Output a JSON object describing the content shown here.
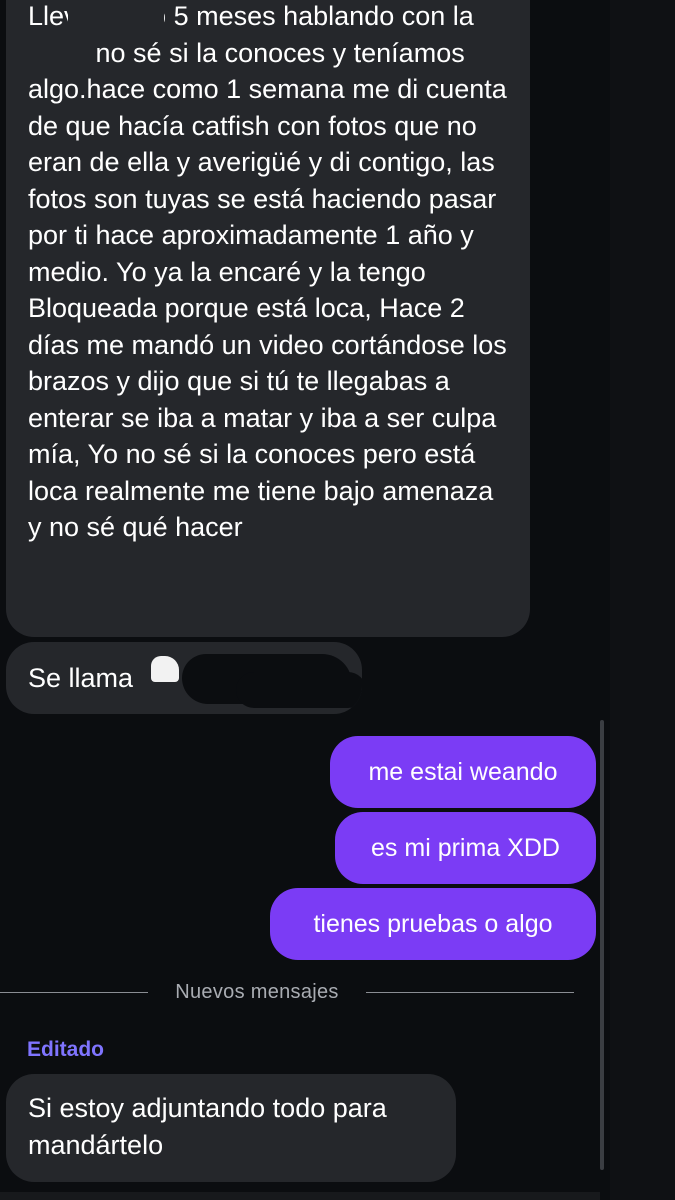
{
  "messages": {
    "incoming_long": "Llevo como 5 meses hablando con la          no sé si la conoces y teníamos algo.hace como 1 semana me di cuenta de que hacía catfish con fotos que no eran de ella y averigüé y di contigo, las fotos son tuyas se está haciendo pasar por ti hace aproximadamente 1 año y medio. Yo ya la encaré y la tengo Bloqueada porque está loca, Hace 2 días me mandó un video cortándose los brazos y dijo que si tú te llegabas a enterar se iba a matar y iba a ser culpa mía, Yo no sé si la conoces pero está loca realmente me tiene bajo amenaza y no sé qué hacer",
    "incoming_name": "Se llama",
    "outgoing_1": "me estai weando",
    "outgoing_2": "es mi prima XDD",
    "outgoing_3": "tienes pruebas o algo",
    "incoming_last": "Si estoy  adjuntando todo para mandártelo"
  },
  "divider": {
    "label": "Nuevos mensajes"
  },
  "edited_label": "Editado",
  "colors": {
    "background": "#0b0d10",
    "incoming_bubble": "#25272b",
    "outgoing_bubble": "#7b3cf5",
    "edited_label": "#7f74ff",
    "divider_text": "#a9acb2"
  }
}
